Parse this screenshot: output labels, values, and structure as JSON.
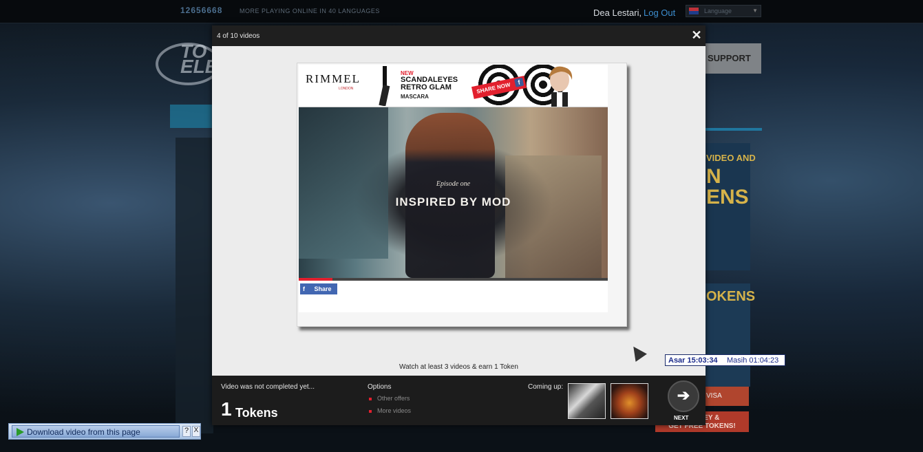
{
  "background": {
    "players_count": "12656668",
    "players_text": "MORE PLAYING ONLINE IN 40 LANGUAGES",
    "user_name": "Dea Lestari,",
    "logout_label": "Log Out",
    "language": "Language",
    "logo_text": "TO\nELE",
    "support_label": "SUPPORT",
    "promo_text": "VIDEO AND",
    "promo_big": "N\nENS",
    "tokens_text": "OKENS",
    "visa_text": "VISA",
    "survey_text": "SURVEY &\nGET FREE TOKENS!"
  },
  "modal": {
    "video_counter": "4 of 10 videos",
    "close_symbol": "✕",
    "ad": {
      "brand": "RIMMEL",
      "brand_sub": "LONDON",
      "new_label": "NEW",
      "line1": "SCANDALEYES",
      "line2": "RETRO GLAM",
      "line3": "MASCARA",
      "share_now": "SHARE NOW",
      "fb_letter": "f"
    },
    "video": {
      "episode": "Episode one",
      "title": "INSPIRED BY MOD",
      "progress_fraction": 0.11
    },
    "fb_share_icon": "f",
    "fb_share_label": "Share",
    "watch_message": "Watch at least 3 videos & earn 1 Token",
    "footer": {
      "not_complete": "Video was not completed yet...",
      "tokens_number": "1",
      "tokens_label": "Tokens",
      "options_title": "Options",
      "options": [
        "Other offers",
        "More videos"
      ],
      "coming_up_title": "Coming up:",
      "next_arrow": "➔",
      "next_label": "NEXT"
    }
  },
  "clock": {
    "left": "Asar 15:03:34",
    "right": "Masih 01:04:23"
  },
  "download_bar": {
    "label": "Download video from this page",
    "help": "?",
    "close": "X"
  },
  "colors": {
    "accent_red": "#e2202e",
    "facebook_blue": "#4267b2",
    "link_blue": "#3d8fd1"
  }
}
